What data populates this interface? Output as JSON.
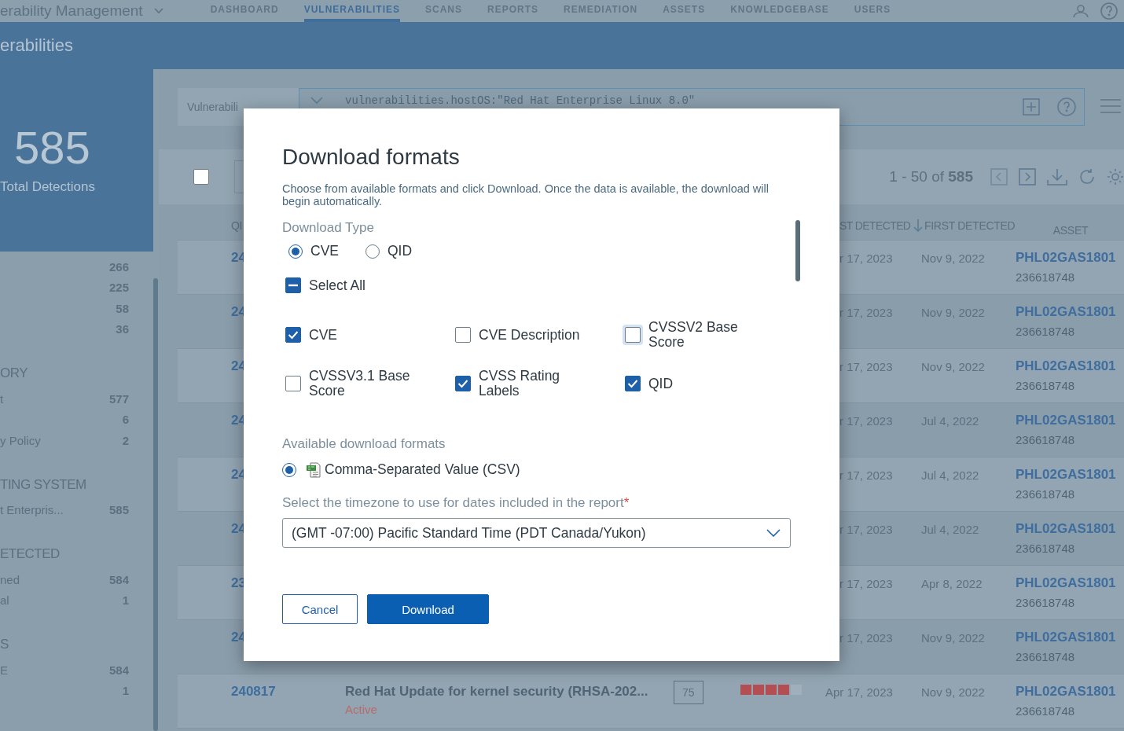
{
  "app_header": {
    "product": "erability Management",
    "nav": [
      {
        "label": "DASHBOARD",
        "selected": false
      },
      {
        "label": "VULNERABILITIES",
        "selected": true
      },
      {
        "label": "SCANS",
        "selected": false
      },
      {
        "label": "REPORTS",
        "selected": false
      },
      {
        "label": "REMEDIATION",
        "selected": false
      },
      {
        "label": "ASSETS",
        "selected": false
      },
      {
        "label": "KNOWLEDGEBASE",
        "selected": false
      },
      {
        "label": "USERS",
        "selected": false
      }
    ]
  },
  "page_title": "erabilities",
  "summary": {
    "count": "585",
    "label": "Total Detections"
  },
  "sidebar": {
    "groups": [
      {
        "items": [
          {
            "count": "266"
          },
          {
            "count": "225"
          },
          {
            "count": "58"
          },
          {
            "count": "36"
          }
        ]
      },
      {
        "heading": "ORY",
        "items": [
          {
            "label": "t",
            "count": "577"
          },
          {
            "count": "6"
          },
          {
            "label": "y Policy",
            "count": "2"
          }
        ]
      },
      {
        "heading": "TING SYSTEM",
        "items": [
          {
            "label": "t Enterpris...",
            "count": "585"
          }
        ]
      },
      {
        "heading": "ETECTED",
        "items": [
          {
            "label": "ned",
            "count": "584"
          },
          {
            "label": "al",
            "count": "1"
          }
        ]
      },
      {
        "heading": "S",
        "items": [
          {
            "label": "E",
            "count": "584"
          },
          {
            "count": "1"
          }
        ]
      }
    ]
  },
  "search": {
    "scope": "Vulnerabili",
    "query": "vulnerabilities.hostOS:\"Red Hat Enterprise Linux 8.0\""
  },
  "toolbar": {
    "select_all_checked": false,
    "range": "1 - 50 of",
    "total": "585"
  },
  "table": {
    "columns": [
      {
        "label": "QI"
      },
      {
        "label": "ST DETECTED",
        "sorted": true
      },
      {
        "label": "FIRST DETECTED"
      },
      {
        "label": "ASSET"
      }
    ],
    "rows": [
      {
        "qid": "24",
        "last_detected": "r 17, 2023",
        "first_detected": "Nov 9, 2022",
        "asset": "PHL02GAS1801",
        "asset_id": "236618748"
      },
      {
        "qid": "24",
        "last_detected": "r 17, 2023",
        "first_detected": "Nov 9, 2022",
        "asset": "PHL02GAS1801",
        "asset_id": "236618748"
      },
      {
        "qid": "24",
        "last_detected": "r 17, 2023",
        "first_detected": "Nov 9, 2022",
        "asset": "PHL02GAS1801",
        "asset_id": "236618748"
      },
      {
        "qid": "24",
        "last_detected": "r 17, 2023",
        "first_detected": "Jul 4, 2022",
        "asset": "PHL02GAS1801",
        "asset_id": "236618748"
      },
      {
        "qid": "24",
        "last_detected": "r 17, 2023",
        "first_detected": "Jul 4, 2022",
        "asset": "PHL02GAS1801",
        "asset_id": "236618748"
      },
      {
        "qid": "24",
        "last_detected": "r 17, 2023",
        "first_detected": "Jul 4, 2022",
        "asset": "PHL02GAS1801",
        "asset_id": "236618748"
      },
      {
        "qid": "23",
        "last_detected": "r 17, 2023",
        "first_detected": "Apr 8, 2022",
        "asset": "PHL02GAS1801",
        "asset_id": "236618748"
      },
      {
        "qid": "24",
        "last_detected": "r 17, 2023",
        "first_detected": "Nov 9, 2022",
        "asset": "PHL02GAS1801",
        "asset_id": "236618748"
      },
      {
        "qid": "240817",
        "title": "Red Hat Update for kernel security (RHSA-202...",
        "status": "Active",
        "qds": "75",
        "level": 0.8,
        "last_detected": "Apr 17, 2023",
        "first_detected": "Nov 9, 2022",
        "asset": "PHL02GAS1801",
        "asset_id": "236618748"
      }
    ]
  },
  "dialog": {
    "title": "Download formats",
    "description": "Choose from available formats and click Download. Once the data is available, the download will begin automatically.",
    "download_type": {
      "label": "Download Type",
      "options": [
        {
          "label": "CVE",
          "selected": true
        },
        {
          "label": "QID",
          "selected": false
        }
      ]
    },
    "select_all": {
      "label": "Select All",
      "indeterminate": true
    },
    "fields": [
      {
        "label": "CVE",
        "checked": true,
        "focused": false
      },
      {
        "label": "CVE Description",
        "checked": false,
        "focused": false
      },
      {
        "label": "CVSSV2 Base Score",
        "checked": false,
        "focused": true
      },
      {
        "label": "CVSSV3.1 Base Score",
        "checked": false,
        "focused": false
      },
      {
        "label": "CVSS Rating Labels",
        "checked": true,
        "focused": false
      },
      {
        "label": "QID",
        "checked": true,
        "focused": false
      }
    ],
    "formats": {
      "label": "Available download formats",
      "options": [
        {
          "label": "Comma-Separated Value (CSV)",
          "selected": true
        }
      ]
    },
    "timezone": {
      "label": "Select the timezone to use for dates included in the report",
      "required_mark": "*",
      "value": "(GMT -07:00) Pacific Standard Time (PDT Canada/Yukon)"
    },
    "buttons": [
      {
        "label": "Cancel",
        "kind": "secondary"
      },
      {
        "label": "Download",
        "kind": "primary"
      }
    ]
  }
}
